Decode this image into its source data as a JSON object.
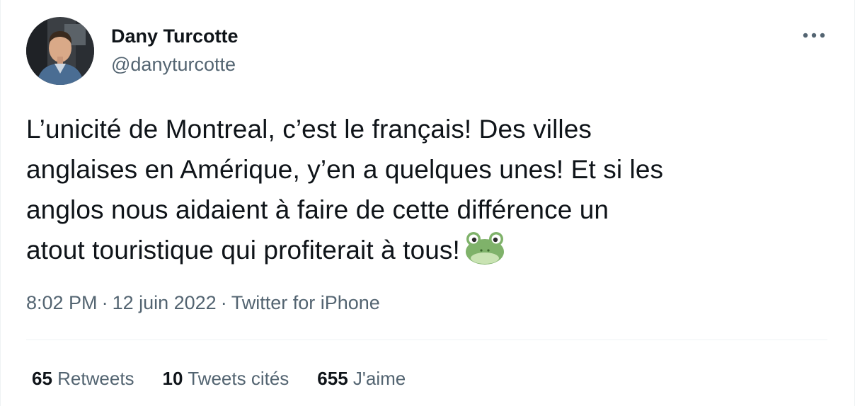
{
  "author": {
    "name": "Dany Turcotte",
    "handle": "@danyturcotte"
  },
  "tweet": {
    "lines": [
      "L’unicité de Montreal, c’est le français! Des villes",
      "anglaises en Amérique, y’en a quelques unes! Et si les",
      "anglos nous aidaient à faire de cette différence un",
      "atout touristique qui profiterait à tous!"
    ],
    "emoji": "frog-face-icon"
  },
  "meta": {
    "time": "8:02 PM",
    "separator": "·",
    "date": "12 juin 2022",
    "source": "Twitter for iPhone"
  },
  "stats": {
    "retweets": {
      "count": "65",
      "label": "Retweets"
    },
    "quotes": {
      "count": "10",
      "label": "Tweets cités"
    },
    "likes": {
      "count": "655",
      "label": "J'aime"
    }
  },
  "colors": {
    "text_primary": "#0f1419",
    "text_secondary": "#536471",
    "divider": "#eff3f4",
    "frog_green": "#7fb26a"
  }
}
